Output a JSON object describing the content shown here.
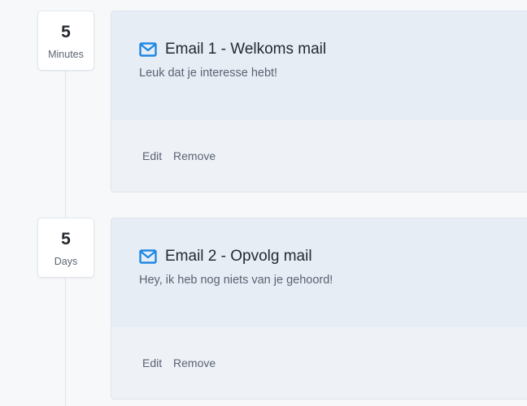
{
  "steps": [
    {
      "delay_value": "5",
      "delay_unit": "Minutes",
      "icon": "mail-icon",
      "title": "Email 1 - Welkoms mail",
      "subtitle": "Leuk dat je interesse hebt!",
      "edit_label": "Edit",
      "remove_label": "Remove"
    },
    {
      "delay_value": "5",
      "delay_unit": "Days",
      "icon": "mail-icon",
      "title": "Email 2 - Opvolg mail",
      "subtitle": "Hey, ik heb nog niets van je gehoord!",
      "edit_label": "Edit",
      "remove_label": "Remove"
    }
  ],
  "colors": {
    "accent": "#1e88e5",
    "card_top": "#e6edf5",
    "card_bottom": "#eef2f7"
  }
}
